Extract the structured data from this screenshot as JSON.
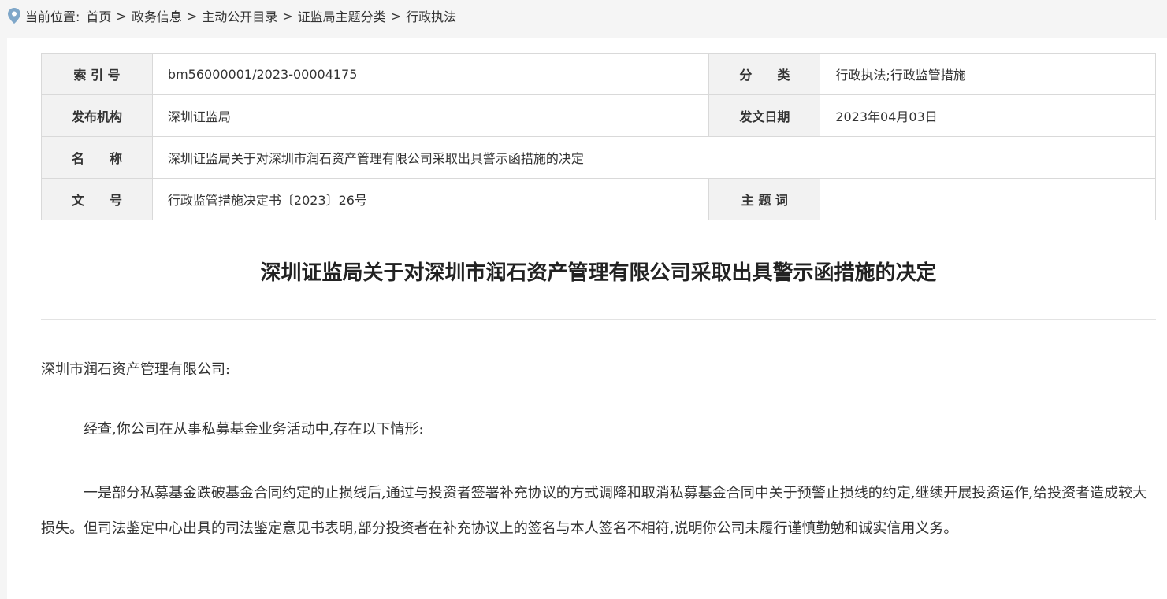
{
  "breadcrumb": {
    "prefix": "当前位置:",
    "items": [
      "首页",
      "政务信息",
      "主动公开目录",
      "证监局主题分类",
      "行政执法"
    ],
    "separator": ">"
  },
  "meta": {
    "index_label": "索 引 号",
    "index_value": "bm56000001/2023-00004175",
    "category_label": "分　　类",
    "category_value": "行政执法;行政监管措施",
    "publisher_label": "发布机构",
    "publisher_value": "深圳证监局",
    "date_label": "发文日期",
    "date_value": "2023年04月03日",
    "name_label": "名　　称",
    "name_value": "深圳证监局关于对深圳市润石资产管理有限公司采取出具警示函措施的决定",
    "docno_label": "文　　号",
    "docno_value": "行政监管措施决定书〔2023〕26号",
    "keyword_label": "主 题 词",
    "keyword_value": ""
  },
  "article": {
    "title": "深圳证监局关于对深圳市润石资产管理有限公司采取出具警示函措施的决定",
    "salutation": "深圳市润石资产管理有限公司:",
    "para1": "经查,你公司在从事私募基金业务活动中,存在以下情形:",
    "para2": "一是部分私募基金跌破基金合同约定的止损线后,通过与投资者签署补充协议的方式调降和取消私募基金合同中关于预警止损线的约定,继续开展投资运作,给投资者造成较大损失。但司法鉴定中心出具的司法鉴定意见书表明,部分投资者在补充协议上的签名与本人签名不相符,说明你公司未履行谨慎勤勉和诚实信用义务。"
  },
  "colors": {
    "page_bg": "#f5f5f5",
    "label_bg": "#f2f2f2",
    "border": "#d9d9d9",
    "pin": "#7fa7c9"
  }
}
